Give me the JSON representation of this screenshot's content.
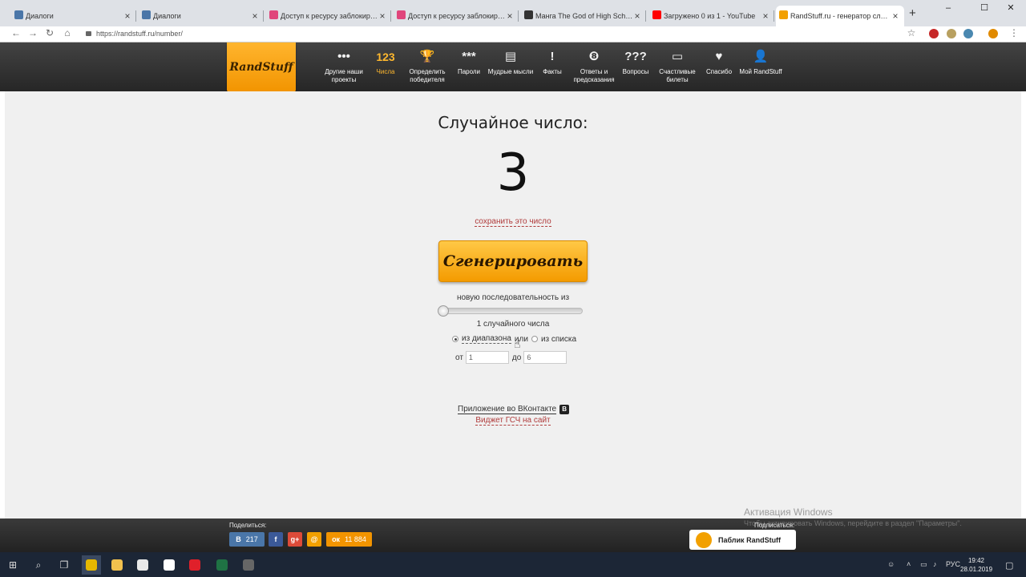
{
  "browser": {
    "tabs": [
      {
        "title": "Диалоги",
        "favicon_color": "#4a76a8"
      },
      {
        "title": "Диалоги",
        "favicon_color": "#4a76a8"
      },
      {
        "title": "Доступ к ресурсу заблокирован",
        "favicon_color": "#e0457b"
      },
      {
        "title": "Доступ к ресурсу заблокирован",
        "favicon_color": "#e0457b"
      },
      {
        "title": "Манга The God of High School online",
        "favicon_color": "#333333"
      },
      {
        "title": "Загружено 0 из 1 - YouTube",
        "favicon_color": "#ff0000"
      },
      {
        "title": "RandStuff.ru - генератор случайных",
        "favicon_color": "#f2a000"
      }
    ],
    "new_tab": "+",
    "window_controls": {
      "minimize": "–",
      "maximize": "☐",
      "close": "✕"
    },
    "nav": {
      "back": "←",
      "forward": "→",
      "reload": "↻",
      "home": "⌂"
    },
    "url": "https://randstuff.ru/number/",
    "star": "☆"
  },
  "site": {
    "logo": "RandStuff",
    "nav": [
      {
        "icon": "•••",
        "label": "Другие наши проекты"
      },
      {
        "icon": "123",
        "label": "Числа",
        "active": true
      },
      {
        "icon": "🏆",
        "label": "Определить победителя"
      },
      {
        "icon": "***",
        "label": "Пароли"
      },
      {
        "icon": "▤",
        "label": "Мудрые мысли"
      },
      {
        "icon": "!",
        "label": "Факты"
      },
      {
        "icon": "❽",
        "label": "Ответы и предсказания"
      },
      {
        "icon": "???",
        "label": "Вопросы"
      },
      {
        "icon": "▭",
        "label": "Счастливые билеты"
      },
      {
        "icon": "♥",
        "label": "Спасибо"
      },
      {
        "icon": "👤",
        "label": "Мой RandStuff"
      }
    ]
  },
  "generator": {
    "title": "Случайное число:",
    "result": "3",
    "save_link": "сохранить это число",
    "button": "Сгенерировать",
    "sequence_label": "новую последовательность из",
    "count_label": "1 случайного числа",
    "slider_level": 0,
    "mode_range": "из диапазона",
    "or": "или",
    "mode_list": "из списка",
    "from_label": "от",
    "from_value": "1",
    "to_label": "до",
    "to_value": "6"
  },
  "links": {
    "vk_app": "Приложение во ВКонтакте",
    "vk_badge": "В",
    "widget": "Виджет ГСЧ на сайт"
  },
  "footer": {
    "share_label": "Поделиться:",
    "share": [
      {
        "icon": "B",
        "count": "217",
        "color": "#4a76a8"
      },
      {
        "icon": "f",
        "color": "#3b5998"
      },
      {
        "icon": "g+",
        "color": "#dd4b39"
      },
      {
        "icon": "@",
        "color": "#f2a000"
      },
      {
        "icon": "ок",
        "count": "11 884",
        "color": "#f29400"
      }
    ],
    "subscribe_label": "Подписаться:",
    "public_button": "Паблик RandStuff",
    "activation_title": "Активация Windows",
    "activation_text": "Чтобы активировать Windows, перейдите в раздел \"Параметры\"."
  },
  "taskbar": {
    "language": "РУС",
    "time": "19:42",
    "date": "28.01.2019",
    "apps": [
      {
        "name": "start",
        "icon": "⊞"
      },
      {
        "name": "search",
        "icon": "⌕"
      },
      {
        "name": "task-view",
        "icon": "❐"
      },
      {
        "name": "chrome",
        "color": "#e6b800"
      },
      {
        "name": "explorer",
        "color": "#f2c14e"
      },
      {
        "name": "store",
        "color": "#e9e9e9"
      },
      {
        "name": "mail",
        "color": "#ffffff"
      },
      {
        "name": "opera",
        "color": "#e0202a"
      },
      {
        "name": "excel",
        "color": "#1f7244"
      },
      {
        "name": "app",
        "color": "#666666"
      }
    ]
  }
}
